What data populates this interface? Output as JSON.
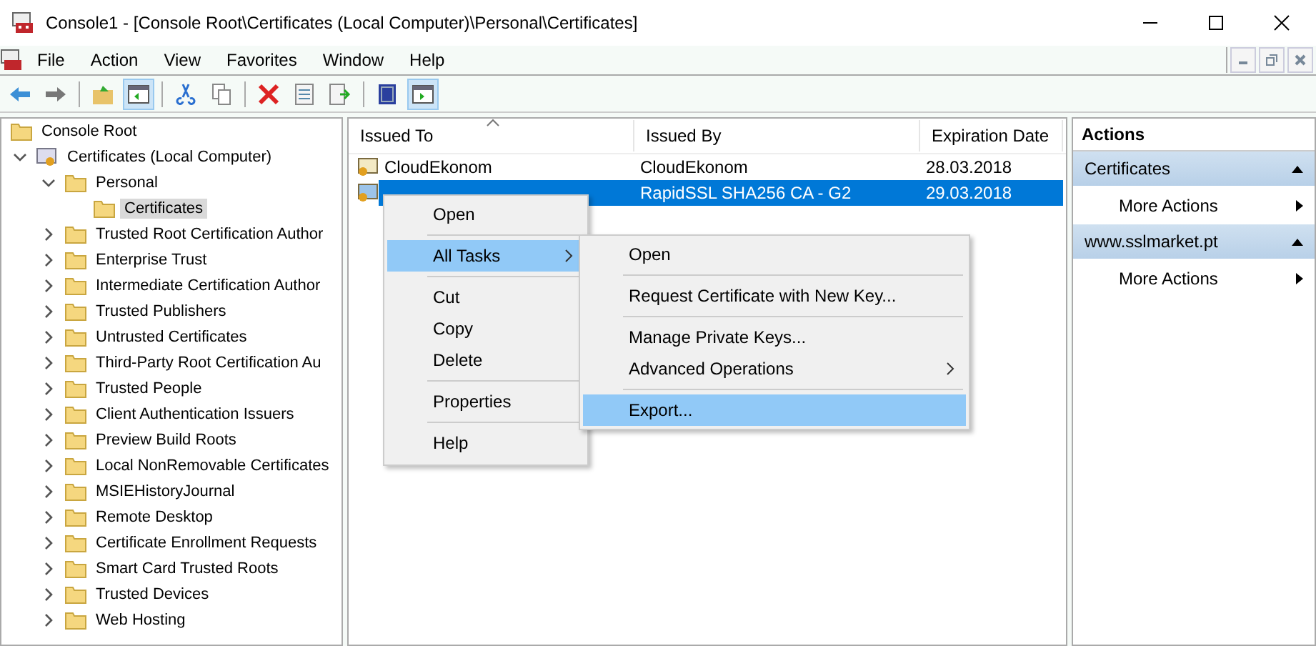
{
  "window": {
    "title": "Console1 - [Console Root\\Certificates (Local Computer)\\Personal\\Certificates]"
  },
  "menu_bar": [
    "File",
    "Action",
    "View",
    "Favorites",
    "Window",
    "Help"
  ],
  "toolbar": [
    [
      {
        "kind": "back",
        "pressed": false
      },
      {
        "kind": "forward",
        "pressed": false
      }
    ],
    [
      {
        "kind": "up",
        "pressed": false
      },
      {
        "kind": "tree",
        "pressed": true
      }
    ],
    [
      {
        "kind": "cut",
        "pressed": false
      },
      {
        "kind": "copy",
        "pressed": false
      }
    ],
    [
      {
        "kind": "delete",
        "pressed": false
      },
      {
        "kind": "properties",
        "pressed": false
      },
      {
        "kind": "export",
        "pressed": false
      }
    ],
    [
      {
        "kind": "help",
        "pressed": false
      },
      {
        "kind": "actionpane",
        "pressed": true
      }
    ]
  ],
  "tree": [
    {
      "label": "Console Root",
      "kind": "folder",
      "selected": false,
      "children": [
        {
          "label": "Certificates (Local Computer)",
          "kind": "store",
          "expanded": true,
          "selected": false,
          "children": [
            {
              "label": "Personal",
              "kind": "folder",
              "expanded": true,
              "selected": false,
              "children": [
                {
                  "label": "Certificates",
                  "kind": "folder",
                  "selected": true
                }
              ]
            },
            {
              "label": "Trusted Root Certification Author",
              "kind": "folder",
              "expanded": false,
              "selected": false
            },
            {
              "label": "Enterprise Trust",
              "kind": "folder",
              "expanded": false,
              "selected": false
            },
            {
              "label": "Intermediate Certification Author",
              "kind": "folder",
              "expanded": false,
              "selected": false
            },
            {
              "label": "Trusted Publishers",
              "kind": "folder",
              "expanded": false,
              "selected": false
            },
            {
              "label": "Untrusted Certificates",
              "kind": "folder",
              "expanded": false,
              "selected": false
            },
            {
              "label": "Third-Party Root Certification Au",
              "kind": "folder",
              "expanded": false,
              "selected": false
            },
            {
              "label": "Trusted People",
              "kind": "folder",
              "expanded": false,
              "selected": false
            },
            {
              "label": "Client Authentication Issuers",
              "kind": "folder",
              "expanded": false,
              "selected": false
            },
            {
              "label": "Preview Build Roots",
              "kind": "folder",
              "expanded": false,
              "selected": false
            },
            {
              "label": "Local NonRemovable Certificates",
              "kind": "folder",
              "expanded": false,
              "selected": false
            },
            {
              "label": "MSIEHistoryJournal",
              "kind": "folder",
              "expanded": false,
              "selected": false
            },
            {
              "label": "Remote Desktop",
              "kind": "folder",
              "expanded": false,
              "selected": false
            },
            {
              "label": "Certificate Enrollment Requests",
              "kind": "folder",
              "expanded": false,
              "selected": false
            },
            {
              "label": "Smart Card Trusted Roots",
              "kind": "folder",
              "expanded": false,
              "selected": false
            },
            {
              "label": "Trusted Devices",
              "kind": "folder",
              "expanded": false,
              "selected": false
            },
            {
              "label": "Web Hosting",
              "kind": "folder",
              "expanded": false,
              "selected": false
            }
          ]
        }
      ]
    }
  ],
  "list": {
    "columns": [
      {
        "label": "Issued To",
        "sorted": true
      },
      {
        "label": "Issued By",
        "sorted": false
      },
      {
        "label": "Expiration Date",
        "sorted": false
      }
    ],
    "rows": [
      {
        "issued_to": "CloudEkonom",
        "issued_by": "CloudEkonom",
        "expiration": "28.03.2018",
        "selected": false
      },
      {
        "issued_by": "RapidSSL SHA256 CA - G2",
        "expiration": "29.03.2018",
        "selected": true
      }
    ]
  },
  "context_menu": [
    {
      "kind": "item",
      "label": "Open",
      "highlighted": false,
      "submenu": false
    },
    {
      "kind": "sep"
    },
    {
      "kind": "item",
      "label": "All Tasks",
      "highlighted": true,
      "submenu": true
    },
    {
      "kind": "sep"
    },
    {
      "kind": "item",
      "label": "Cut",
      "highlighted": false,
      "submenu": false
    },
    {
      "kind": "item",
      "label": "Copy",
      "highlighted": false,
      "submenu": false
    },
    {
      "kind": "item",
      "label": "Delete",
      "highlighted": false,
      "submenu": false
    },
    {
      "kind": "sep"
    },
    {
      "kind": "item",
      "label": "Properties",
      "highlighted": false,
      "submenu": false
    },
    {
      "kind": "sep"
    },
    {
      "kind": "item",
      "label": "Help",
      "highlighted": false,
      "submenu": false
    }
  ],
  "submenu": [
    {
      "kind": "item",
      "label": "Open",
      "highlighted": false,
      "submenu": false
    },
    {
      "kind": "sep"
    },
    {
      "kind": "item",
      "label": "Request Certificate with New Key...",
      "highlighted": false,
      "submenu": false
    },
    {
      "kind": "sep"
    },
    {
      "kind": "item",
      "label": "Manage Private Keys...",
      "highlighted": false,
      "submenu": false
    },
    {
      "kind": "item",
      "label": "Advanced Operations",
      "highlighted": false,
      "submenu": true
    },
    {
      "kind": "sep"
    },
    {
      "kind": "item",
      "label": "Export...",
      "highlighted": true,
      "submenu": false
    }
  ],
  "actions": {
    "title": "Actions",
    "sections": [
      {
        "title": "Certificates",
        "items": [
          "More Actions"
        ]
      },
      {
        "title": "www.sslmarket.pt",
        "items": [
          "More Actions"
        ]
      }
    ]
  }
}
